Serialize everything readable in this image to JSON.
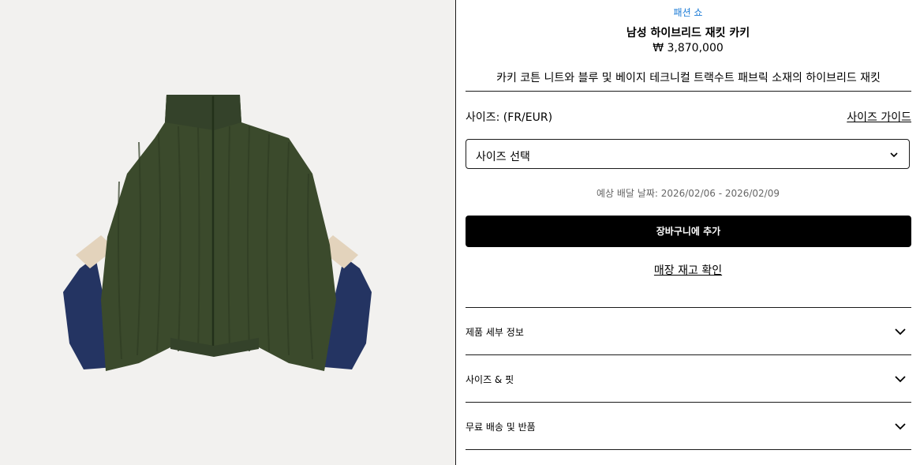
{
  "product": {
    "collection": "패션 쇼",
    "title": "남성 하이브리드 재킷 카키",
    "price": "₩ 3,870,000",
    "description": "카키 코튼 니트와 블루 및 베이지 테크니컬 트랙수트 패브릭 소재의 하이브리드 재킷"
  },
  "size": {
    "label": "사이즈: (FR/EUR)",
    "guide": "사이즈 가이드",
    "select_value": "사이즈 선택"
  },
  "delivery": "예상 배달 날짜: 2026/02/06 - 2026/02/09",
  "actions": {
    "add_to_cart": "장바구니에 추가",
    "check_stock": "매장 재고 확인"
  },
  "accordion": [
    {
      "label": "제품 세부 정보"
    },
    {
      "label": "사이즈 & 핏"
    },
    {
      "label": "무료 배송 및 반품"
    }
  ],
  "colors": {
    "knit": "#3b4a2c",
    "navy": "#243462",
    "beige": "#e3d3bc",
    "link": "#1b7bd6"
  }
}
